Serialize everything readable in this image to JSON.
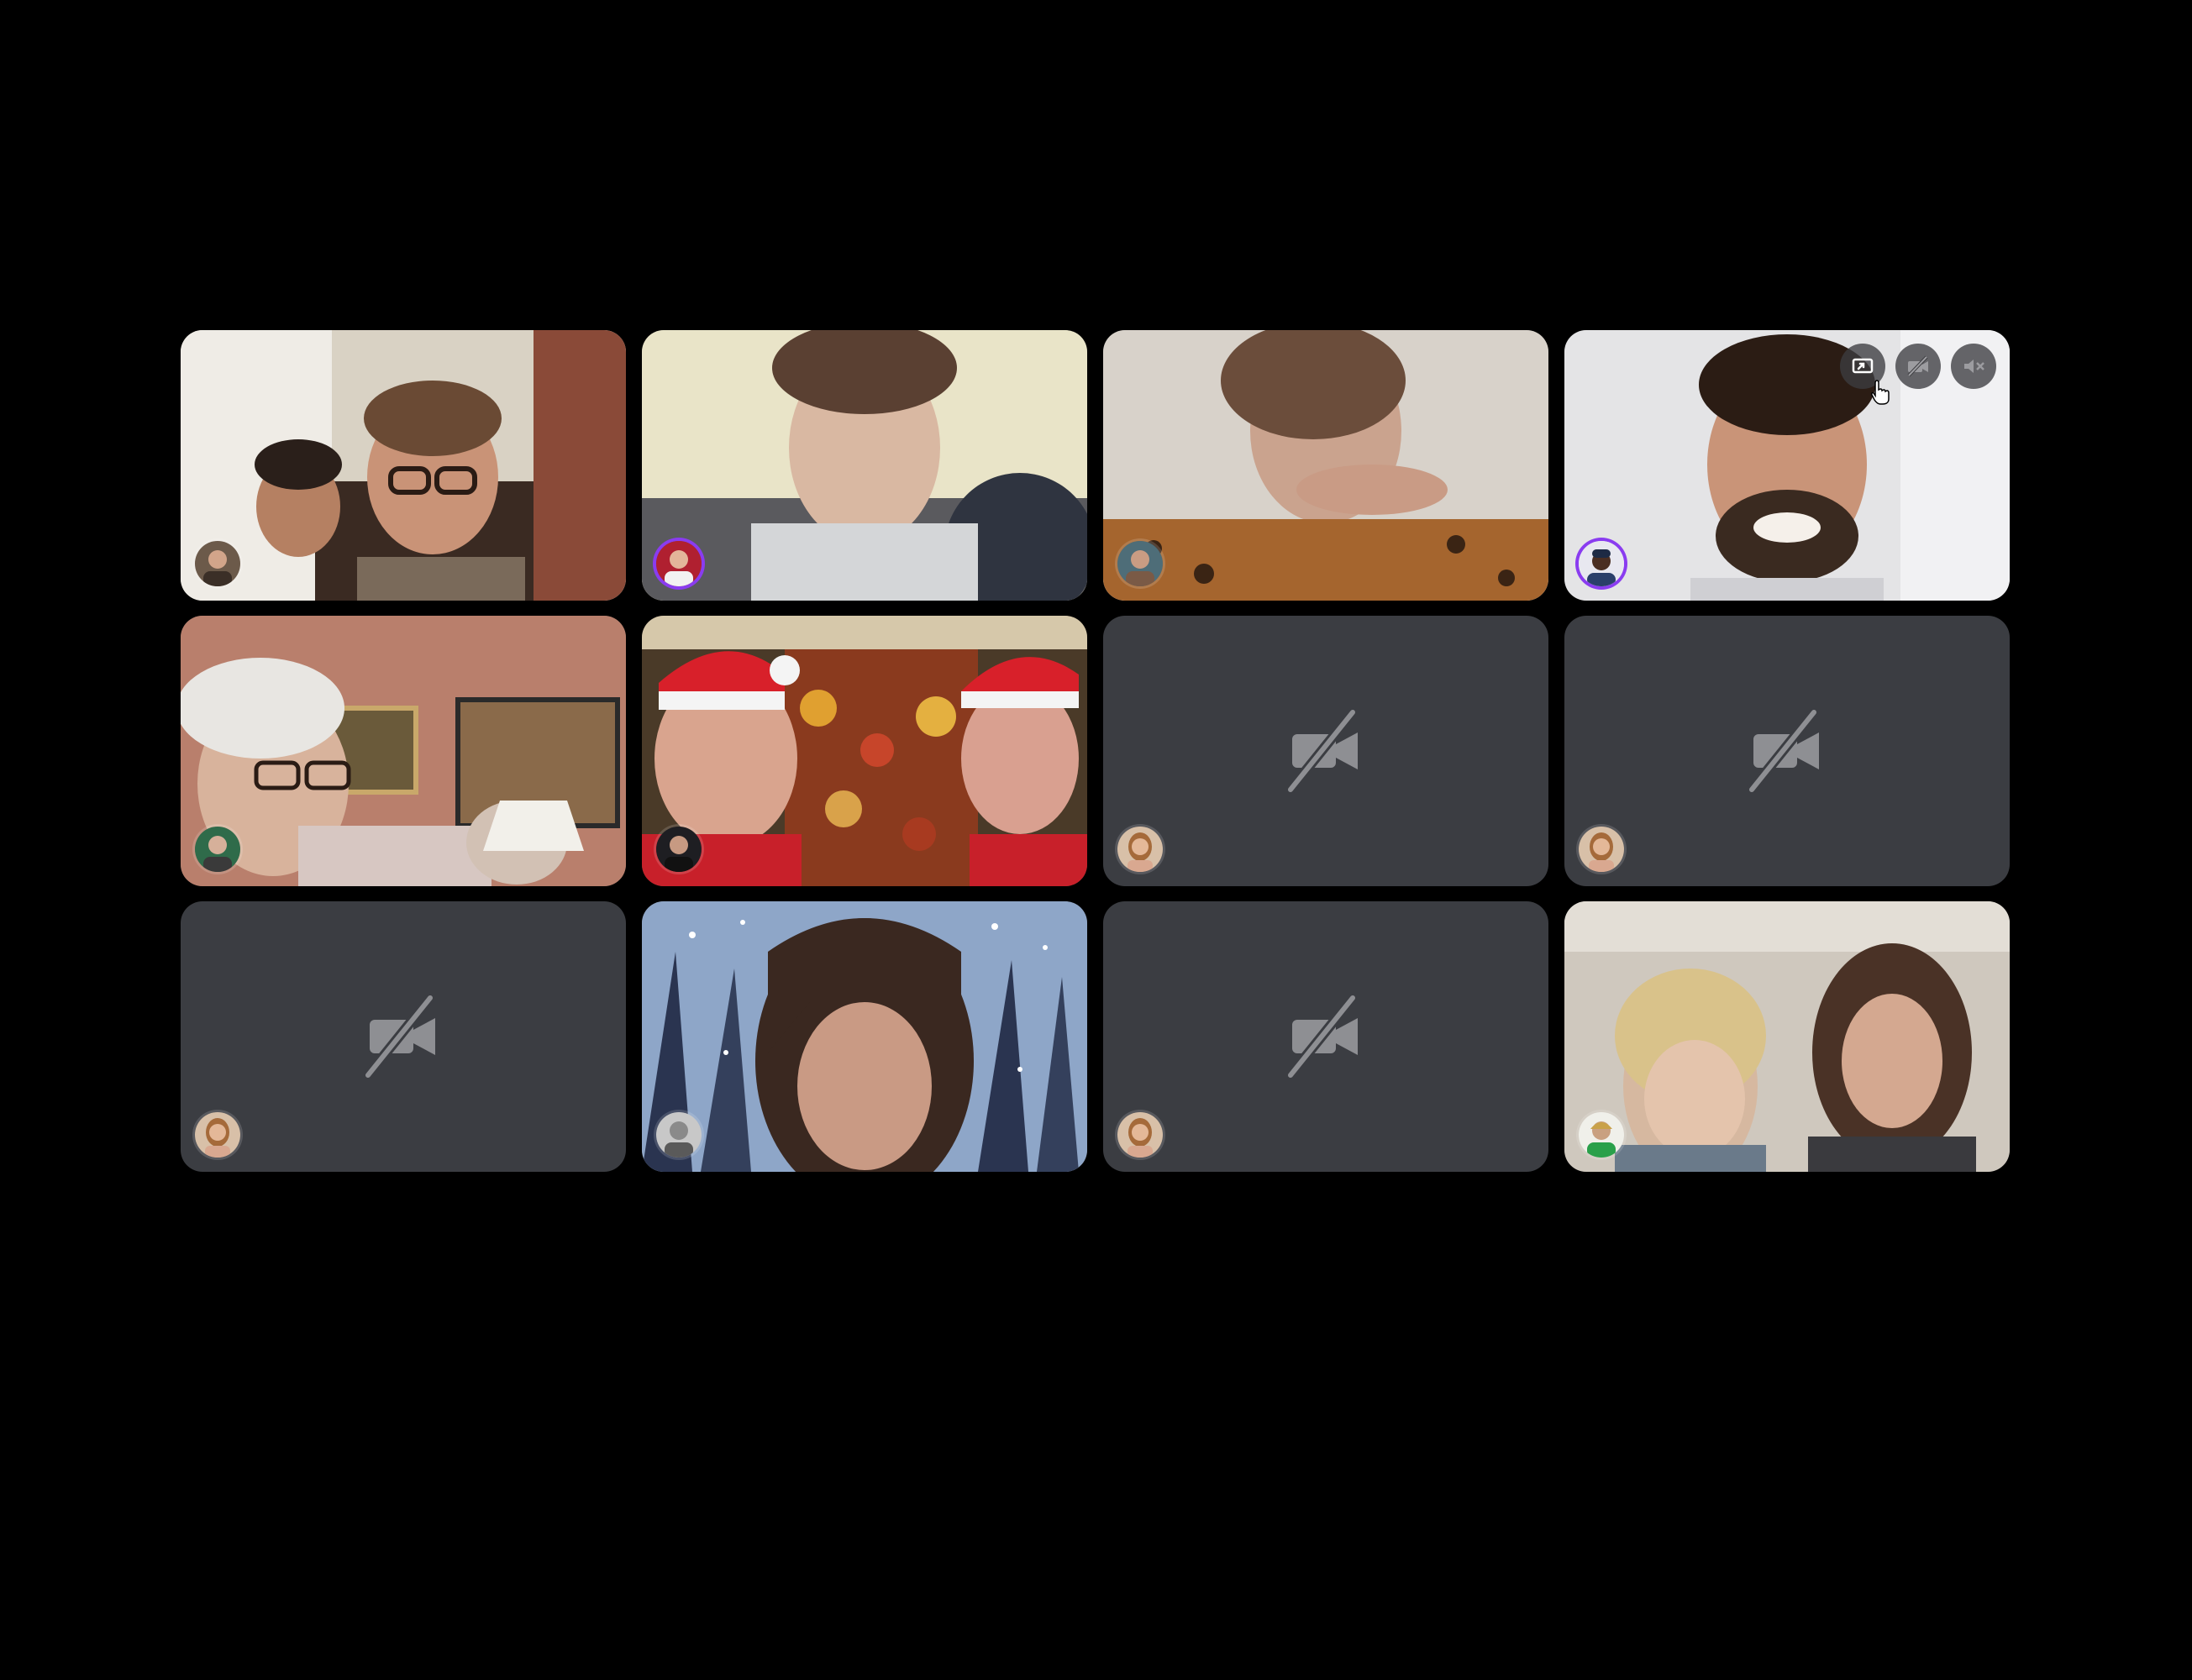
{
  "call": {
    "tiles": [
      {
        "camera": "on",
        "icon": "video-feed",
        "avatar_icon": "participant-avatar"
      },
      {
        "camera": "on",
        "icon": "video-feed",
        "avatar_icon": "participant-avatar"
      },
      {
        "camera": "on",
        "icon": "video-feed",
        "avatar_icon": "participant-avatar"
      },
      {
        "camera": "on",
        "icon": "video-feed",
        "avatar_icon": "participant-avatar",
        "hovered": true
      },
      {
        "camera": "on",
        "icon": "video-feed",
        "avatar_icon": "participant-avatar"
      },
      {
        "camera": "on",
        "icon": "video-feed",
        "avatar_icon": "participant-avatar"
      },
      {
        "camera": "off",
        "icon": "camera-off-icon",
        "avatar_icon": "participant-avatar"
      },
      {
        "camera": "off",
        "icon": "camera-off-icon",
        "avatar_icon": "participant-avatar"
      },
      {
        "camera": "off",
        "icon": "camera-off-icon",
        "avatar_icon": "participant-avatar"
      },
      {
        "camera": "on",
        "icon": "video-feed",
        "avatar_icon": "participant-avatar"
      },
      {
        "camera": "off",
        "icon": "camera-off-icon",
        "avatar_icon": "participant-avatar"
      },
      {
        "camera": "on",
        "icon": "video-feed",
        "avatar_icon": "participant-avatar"
      }
    ],
    "hover_controls": [
      "pin-screen-icon",
      "camera-off-icon",
      "speaker-mute-icon"
    ]
  },
  "colors": {
    "background": "#000000",
    "tile_off": "#3b3d42",
    "icon_muted": "#8e8f93",
    "avatar_ring": "#8a3cf0"
  }
}
